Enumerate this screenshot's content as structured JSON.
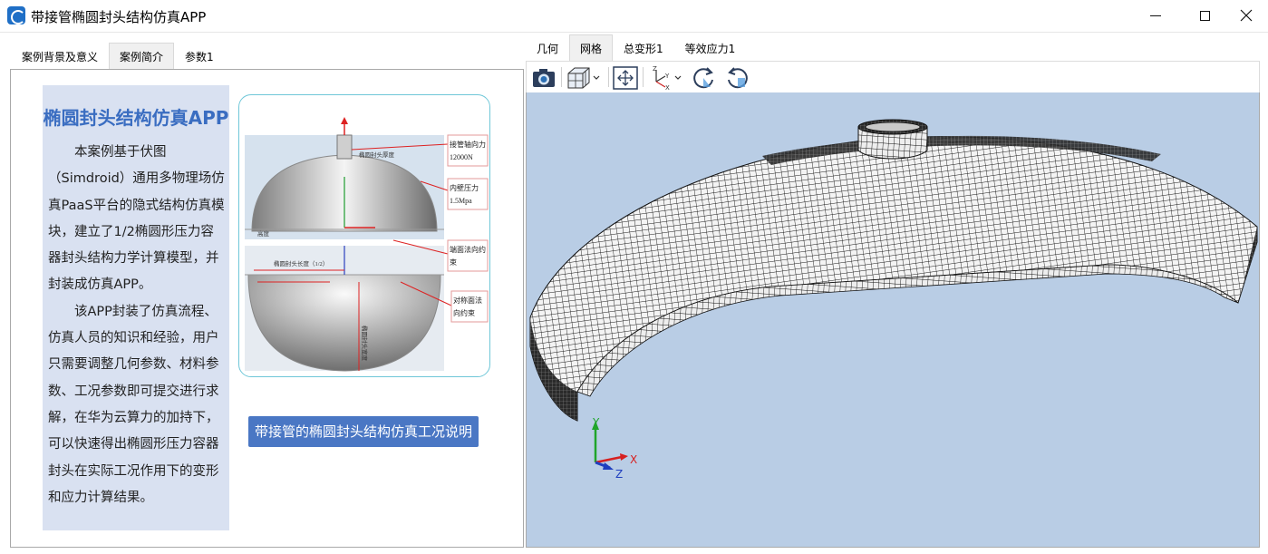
{
  "window": {
    "title": "带接管椭圆封头结构仿真APP",
    "controls": [
      "minimize",
      "maximize",
      "close"
    ]
  },
  "left_panel": {
    "tabs": [
      {
        "label": "案例背景及意义",
        "active": false
      },
      {
        "label": "案例简介",
        "active": true
      },
      {
        "label": "参数1",
        "active": false
      }
    ],
    "card": {
      "title": "椭圆封头结构仿真APP",
      "paragraph1": "本案例基于伏图（Simdroid）通用多物理场仿真PaaS平台的隐式结构仿真模块，建立了1/2椭圆形压力容器封头结构力学计算模型，并封装成仿真APP。",
      "paragraph2": "该APP封装了仿真流程、仿真人员的知识和经验，用户只需要调整几何参数、材料参数、工况参数即可提交进行求解，在华为云算力的加持下，可以快速得出椭圆形压力容器封头在实际工况作用下的变形和应力计算结果。"
    },
    "diagram_labels": {
      "thickness": "椭圆封头厚度",
      "axial_force_line1": "接管轴向力",
      "axial_force_line2": "12000N",
      "pressure_line1": "内壁压力",
      "pressure_line2": "1.5Mpa",
      "height": "高度",
      "end_constraint_line1": "端面法向约",
      "end_constraint_line2": "束",
      "length": "椭圆封头长度（1/2）",
      "symmetry_line1": "对称面法",
      "symmetry_line2": "向约束",
      "width": "椭圆封头宽度"
    },
    "description_button": "带接管的椭圆封头结构仿真工况说明"
  },
  "right_panel": {
    "tabs": [
      {
        "label": "几何",
        "active": false
      },
      {
        "label": "网格",
        "active": true
      },
      {
        "label": "总变形1",
        "active": false
      },
      {
        "label": "等效应力1",
        "active": false
      }
    ],
    "toolbar": [
      "camera-icon",
      "view-cube-icon",
      "fit-view-icon",
      "axes-orientation-icon",
      "rotate-cw-icon",
      "rotate-ccw-icon"
    ],
    "triad": {
      "x": "X",
      "y": "Y",
      "z": "Z"
    },
    "colors": {
      "viewport_bg": "#b9cde5",
      "mesh": "#1a1a1a",
      "x_axis": "#d62020",
      "y_axis": "#1fa52a",
      "z_axis": "#1f3fbf"
    }
  }
}
